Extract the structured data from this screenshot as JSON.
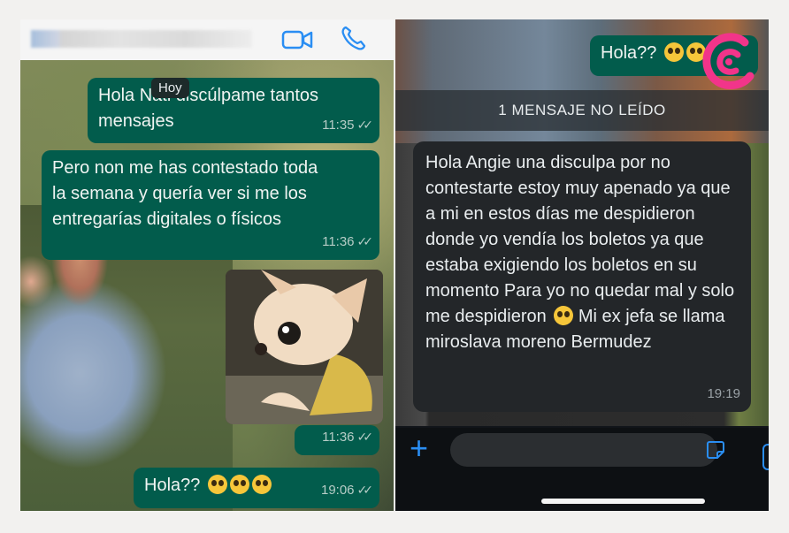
{
  "left": {
    "date_chip": "Hoy",
    "messages": [
      {
        "text": "Hola Nati discúlpame tantos\nmensajes",
        "time": "11:35"
      },
      {
        "text": "Pero non me has contestado toda\nla semana y quería ver si me los\nentregarías digitales o físicos",
        "time": "11:36"
      },
      {
        "text": "",
        "time": "11:36"
      },
      {
        "text": "Hola??",
        "time": "19:06"
      }
    ]
  },
  "right": {
    "top_message": {
      "text": "Hola??"
    },
    "unread_banner": "1 MENSAJE NO LEÍDO",
    "incoming": {
      "text": "Hola Angie una disculpa por no\ncontestarte estoy muy apenado ya\nque a mi en estos días me\ndespidieron donde yo vendía los\nboletos ya que estaba exigiendo\nlos boletos en su momento\nPara yo no quedar mal y solo me\ndespidieron",
      "text2": "Mi  ex jefa se llama miroslava\nmoreno Bermudez",
      "time": "19:19"
    }
  },
  "icons": {
    "video": "video-call-icon",
    "phone": "phone-call-icon",
    "plus": "plus-icon",
    "sticker": "sticker-icon",
    "emoji": "pleading-face-emoji",
    "logo": "brand-logo-icon"
  },
  "colors": {
    "bubble_out": "#025c4c",
    "bubble_in": "#232629",
    "accent_blue": "#2a8ef3",
    "logo_pink": "#f2348a"
  }
}
